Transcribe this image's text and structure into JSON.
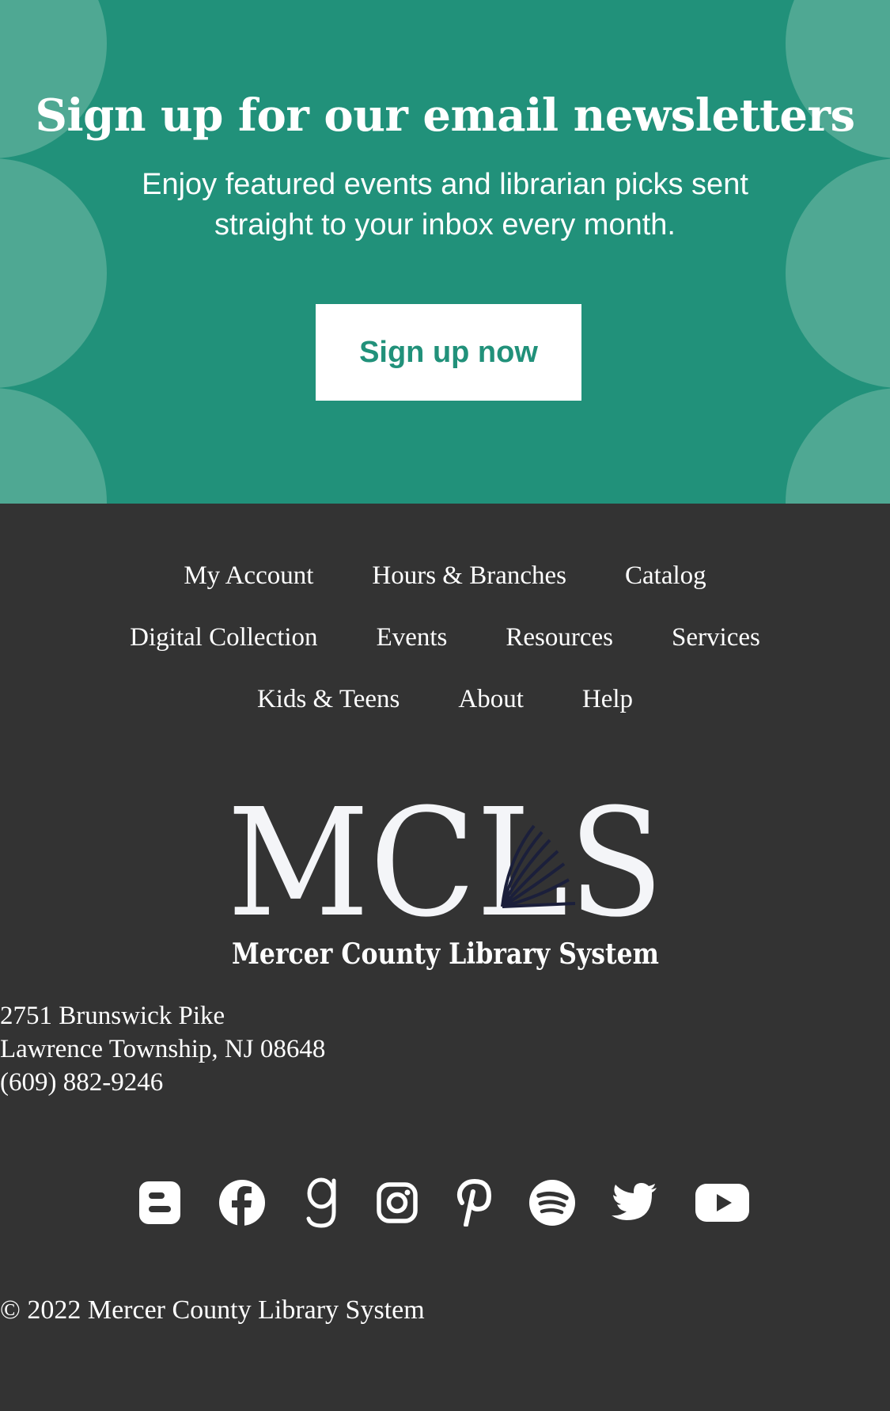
{
  "banner": {
    "title": "Sign up for our email newsletters",
    "subtitle": "Enjoy featured events and librarian picks sent straight to your inbox every month.",
    "button_label": "Sign up now"
  },
  "nav": {
    "row1": [
      "My Account",
      "Hours & Branches",
      "Catalog"
    ],
    "row2": [
      "Digital Collection",
      "Events",
      "Resources",
      "Services"
    ],
    "row3": [
      "Kids & Teens",
      "About",
      "Help"
    ]
  },
  "logo": {
    "letters": "MCLS",
    "name": "Mercer County Library System"
  },
  "address": {
    "street": "2751 Brunswick Pike",
    "city": "Lawrence Township, NJ 08648",
    "phone": "(609) 882-9246"
  },
  "social_icons": [
    "blogger-icon",
    "facebook-icon",
    "goodreads-icon",
    "instagram-icon",
    "pinterest-icon",
    "spotify-icon",
    "twitter-icon",
    "youtube-icon"
  ],
  "copyright": "© 2022 Mercer County Library System",
  "colors": {
    "banner_bg": "#21917a",
    "banner_scallop": "#4fa893",
    "footer_bg": "#333333",
    "text": "#ffffff",
    "logo_book": "#1b1f3b"
  }
}
